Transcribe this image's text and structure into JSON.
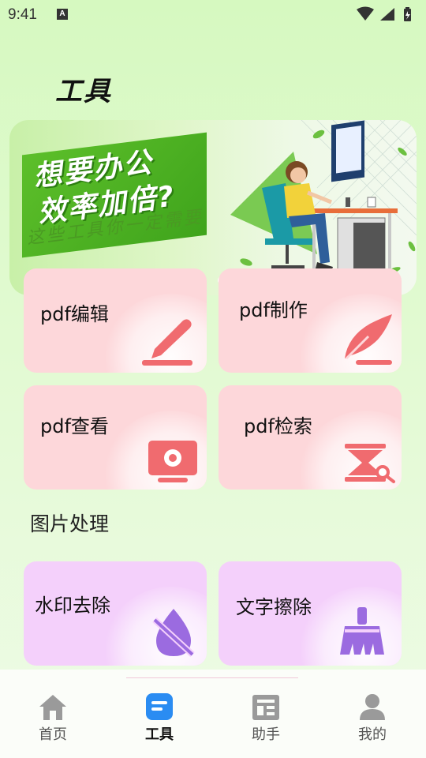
{
  "status": {
    "time": "9:41"
  },
  "page": {
    "title": "工具"
  },
  "banner": {
    "headline_line1": "想要办公",
    "headline_line2": "效率加倍?",
    "subline": "这些工具你一定需要"
  },
  "pdf_tools": [
    {
      "label": "pdf编辑",
      "icon": "pen-icon"
    },
    {
      "label": "pdf制作",
      "icon": "quill-icon"
    },
    {
      "label": "pdf查看",
      "icon": "monitor-icon"
    },
    {
      "label": "pdf检索",
      "icon": "search-doc-icon"
    }
  ],
  "image_section": {
    "title": "图片处理",
    "tools": [
      {
        "label": "水印去除",
        "icon": "watermark-off-icon"
      },
      {
        "label": "文字擦除",
        "icon": "broom-icon"
      }
    ]
  },
  "nav": [
    {
      "label": "首页",
      "icon": "home-icon"
    },
    {
      "label": "工具",
      "icon": "tools-icon",
      "active": true
    },
    {
      "label": "助手",
      "icon": "assistant-icon"
    },
    {
      "label": "我的",
      "icon": "profile-icon"
    }
  ],
  "colors": {
    "pdf_card": "#fdd7da",
    "image_card": "#f4d0fb",
    "pdf_icon": "#f06b6f",
    "image_icon": "#9b6be0",
    "active_nav": "#2a8cf2"
  }
}
